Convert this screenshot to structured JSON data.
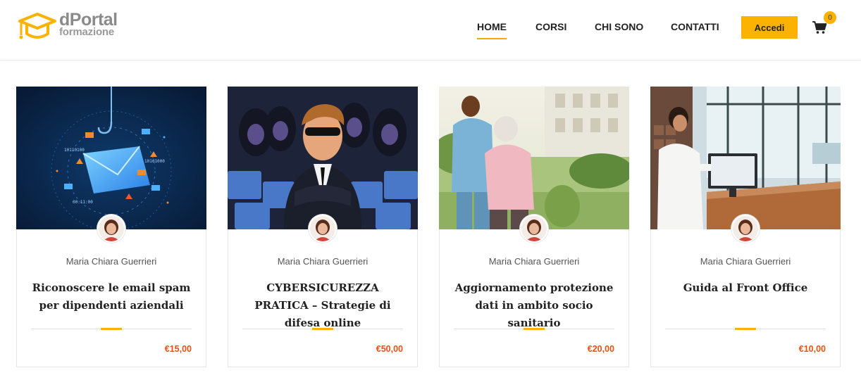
{
  "brand": {
    "name_line1": "dPortal",
    "name_line2": "formazione",
    "accent_color": "#fbb200",
    "icon": "graduation-cap-icon"
  },
  "nav": {
    "items": [
      {
        "label": "HOME",
        "active": true
      },
      {
        "label": "CORSI",
        "active": false
      },
      {
        "label": "CHI SONO",
        "active": false
      },
      {
        "label": "CONTATTI",
        "active": false
      }
    ],
    "login_label": "Accedi",
    "cart_count": "0",
    "cart_icon": "shopping-cart-icon"
  },
  "courses": [
    {
      "author": "Maria Chiara Guerrieri",
      "title": "Riconoscere le email spam per dipendenti aziendali",
      "price": "€15,00",
      "image": "phishing-email-illustration"
    },
    {
      "author": "Maria Chiara Guerrieri",
      "title": "CYBERSICUREZZA PRATICA – Strategie di difesa online",
      "price": "€50,00",
      "image": "security-agent-illustration"
    },
    {
      "author": "Maria Chiara Guerrieri",
      "title": "Aggiornamento protezione dati in ambito socio sanitario",
      "price": "€20,00",
      "image": "caregiver-elderly-photo"
    },
    {
      "author": "Maria Chiara Guerrieri",
      "title": "Guida al Front Office",
      "price": "€10,00",
      "image": "front-office-reception-photo"
    }
  ],
  "colors": {
    "price": "#e8520f",
    "text_dark": "#222222"
  }
}
